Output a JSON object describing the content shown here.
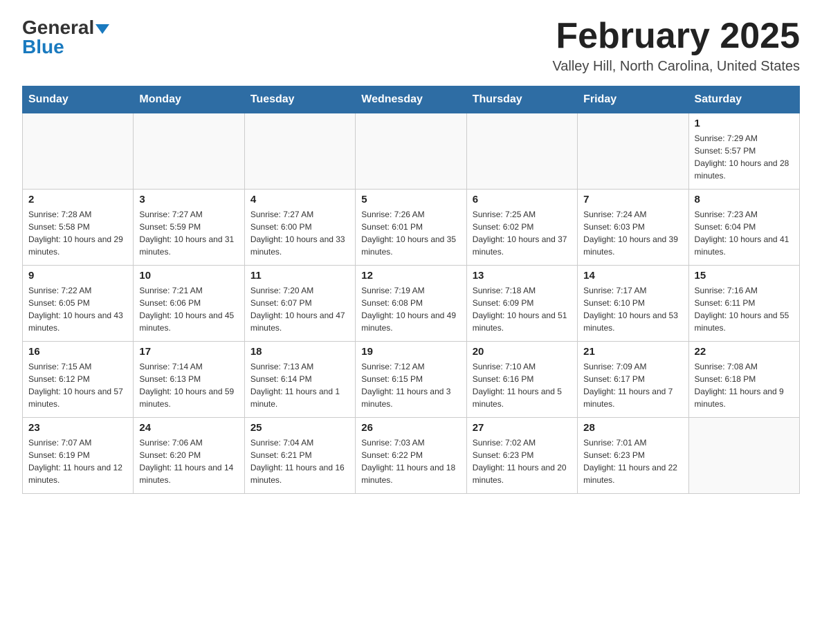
{
  "logo": {
    "general": "General",
    "blue": "Blue"
  },
  "title": "February 2025",
  "location": "Valley Hill, North Carolina, United States",
  "weekdays": [
    "Sunday",
    "Monday",
    "Tuesday",
    "Wednesday",
    "Thursday",
    "Friday",
    "Saturday"
  ],
  "weeks": [
    [
      {
        "day": "",
        "info": ""
      },
      {
        "day": "",
        "info": ""
      },
      {
        "day": "",
        "info": ""
      },
      {
        "day": "",
        "info": ""
      },
      {
        "day": "",
        "info": ""
      },
      {
        "day": "",
        "info": ""
      },
      {
        "day": "1",
        "info": "Sunrise: 7:29 AM\nSunset: 5:57 PM\nDaylight: 10 hours and 28 minutes."
      }
    ],
    [
      {
        "day": "2",
        "info": "Sunrise: 7:28 AM\nSunset: 5:58 PM\nDaylight: 10 hours and 29 minutes."
      },
      {
        "day": "3",
        "info": "Sunrise: 7:27 AM\nSunset: 5:59 PM\nDaylight: 10 hours and 31 minutes."
      },
      {
        "day": "4",
        "info": "Sunrise: 7:27 AM\nSunset: 6:00 PM\nDaylight: 10 hours and 33 minutes."
      },
      {
        "day": "5",
        "info": "Sunrise: 7:26 AM\nSunset: 6:01 PM\nDaylight: 10 hours and 35 minutes."
      },
      {
        "day": "6",
        "info": "Sunrise: 7:25 AM\nSunset: 6:02 PM\nDaylight: 10 hours and 37 minutes."
      },
      {
        "day": "7",
        "info": "Sunrise: 7:24 AM\nSunset: 6:03 PM\nDaylight: 10 hours and 39 minutes."
      },
      {
        "day": "8",
        "info": "Sunrise: 7:23 AM\nSunset: 6:04 PM\nDaylight: 10 hours and 41 minutes."
      }
    ],
    [
      {
        "day": "9",
        "info": "Sunrise: 7:22 AM\nSunset: 6:05 PM\nDaylight: 10 hours and 43 minutes."
      },
      {
        "day": "10",
        "info": "Sunrise: 7:21 AM\nSunset: 6:06 PM\nDaylight: 10 hours and 45 minutes."
      },
      {
        "day": "11",
        "info": "Sunrise: 7:20 AM\nSunset: 6:07 PM\nDaylight: 10 hours and 47 minutes."
      },
      {
        "day": "12",
        "info": "Sunrise: 7:19 AM\nSunset: 6:08 PM\nDaylight: 10 hours and 49 minutes."
      },
      {
        "day": "13",
        "info": "Sunrise: 7:18 AM\nSunset: 6:09 PM\nDaylight: 10 hours and 51 minutes."
      },
      {
        "day": "14",
        "info": "Sunrise: 7:17 AM\nSunset: 6:10 PM\nDaylight: 10 hours and 53 minutes."
      },
      {
        "day": "15",
        "info": "Sunrise: 7:16 AM\nSunset: 6:11 PM\nDaylight: 10 hours and 55 minutes."
      }
    ],
    [
      {
        "day": "16",
        "info": "Sunrise: 7:15 AM\nSunset: 6:12 PM\nDaylight: 10 hours and 57 minutes."
      },
      {
        "day": "17",
        "info": "Sunrise: 7:14 AM\nSunset: 6:13 PM\nDaylight: 10 hours and 59 minutes."
      },
      {
        "day": "18",
        "info": "Sunrise: 7:13 AM\nSunset: 6:14 PM\nDaylight: 11 hours and 1 minute."
      },
      {
        "day": "19",
        "info": "Sunrise: 7:12 AM\nSunset: 6:15 PM\nDaylight: 11 hours and 3 minutes."
      },
      {
        "day": "20",
        "info": "Sunrise: 7:10 AM\nSunset: 6:16 PM\nDaylight: 11 hours and 5 minutes."
      },
      {
        "day": "21",
        "info": "Sunrise: 7:09 AM\nSunset: 6:17 PM\nDaylight: 11 hours and 7 minutes."
      },
      {
        "day": "22",
        "info": "Sunrise: 7:08 AM\nSunset: 6:18 PM\nDaylight: 11 hours and 9 minutes."
      }
    ],
    [
      {
        "day": "23",
        "info": "Sunrise: 7:07 AM\nSunset: 6:19 PM\nDaylight: 11 hours and 12 minutes."
      },
      {
        "day": "24",
        "info": "Sunrise: 7:06 AM\nSunset: 6:20 PM\nDaylight: 11 hours and 14 minutes."
      },
      {
        "day": "25",
        "info": "Sunrise: 7:04 AM\nSunset: 6:21 PM\nDaylight: 11 hours and 16 minutes."
      },
      {
        "day": "26",
        "info": "Sunrise: 7:03 AM\nSunset: 6:22 PM\nDaylight: 11 hours and 18 minutes."
      },
      {
        "day": "27",
        "info": "Sunrise: 7:02 AM\nSunset: 6:23 PM\nDaylight: 11 hours and 20 minutes."
      },
      {
        "day": "28",
        "info": "Sunrise: 7:01 AM\nSunset: 6:23 PM\nDaylight: 11 hours and 22 minutes."
      },
      {
        "day": "",
        "info": ""
      }
    ]
  ]
}
